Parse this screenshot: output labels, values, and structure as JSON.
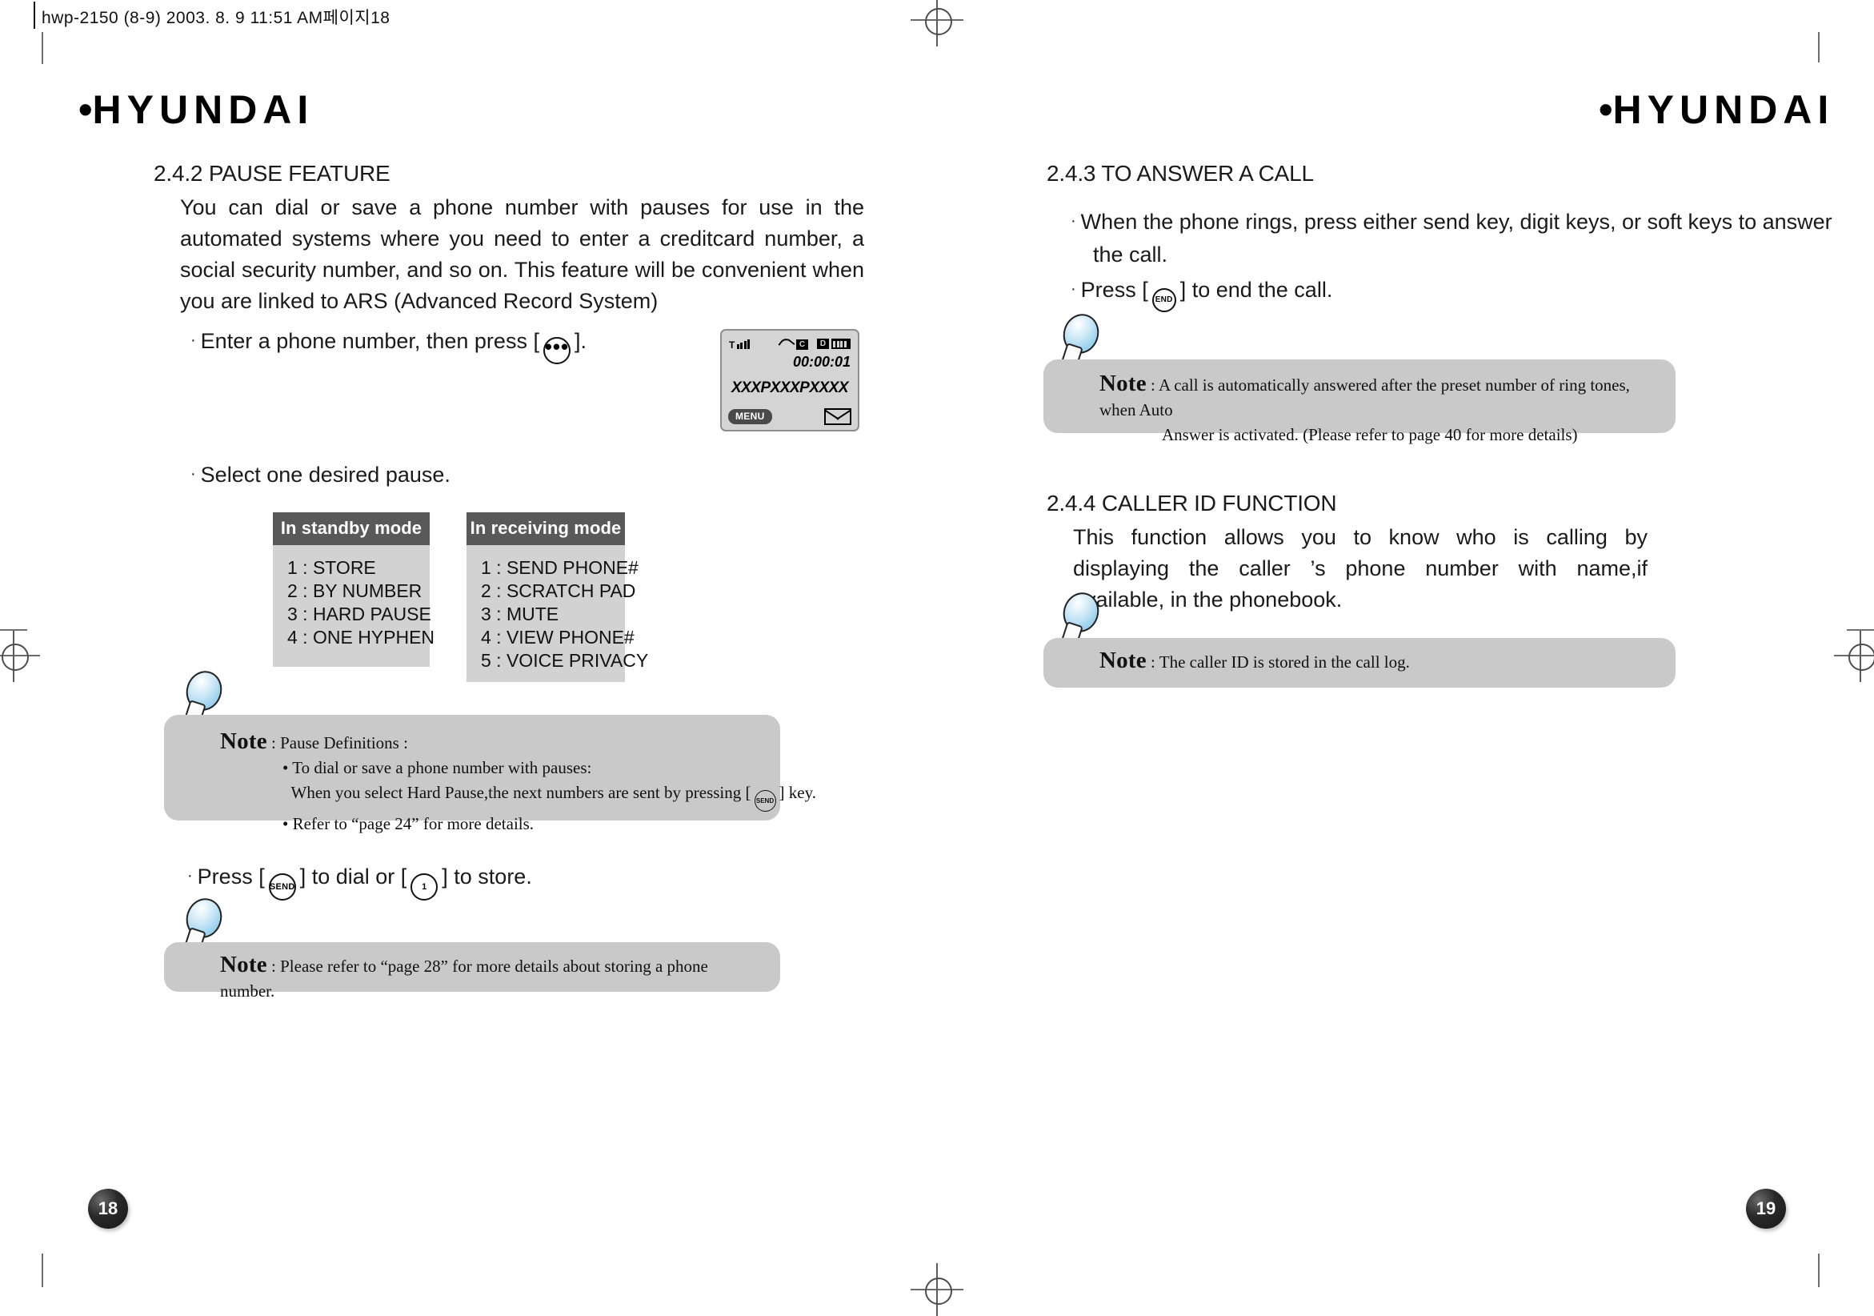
{
  "scan": {
    "header": "hwp-2150 (8-9)  2003. 8. 9 11:51 AM페이지18"
  },
  "brand": {
    "logo_mark": "•",
    "logo_text": "HYUNDAI"
  },
  "left_page": {
    "section_heading": "2.4.2 PAUSE FEATURE",
    "intro_paragraph": "You can dial or save a phone number with pauses for use in the automated systems where you need to enter a creditcard number, a social security number, and so on. This feature will be convenient when you are linked to ARS (Advanced Record System)",
    "step1_before": "Enter a phone number, then press [",
    "step1_key": "•••",
    "step1_after": "].",
    "step2": "Select one desired pause.",
    "step3_before": "Press [",
    "step3_key1": "SEND",
    "step3_middle": "] to dial or [",
    "step3_key2": "1",
    "step3_after": "] to store.",
    "lcd": {
      "timer": "00:00:01",
      "number": "XXXPXXXPXXXX",
      "softkey_left": "MENU",
      "signal_label": "T",
      "call_icon_label": "C",
      "data_icon_label": "D"
    },
    "standby_table": {
      "title": "In standby mode",
      "rows": [
        "1 : STORE",
        "2 : BY NUMBER",
        "3 : HARD PAUSE",
        "4 : ONE HYPHEN"
      ]
    },
    "receiving_table": {
      "title": "In receiving mode",
      "rows": [
        "1 : SEND PHONE#",
        "2 : SCRATCH PAD",
        "3 : MUTE",
        "4 : VIEW PHONE#",
        "5 : VOICE PRIVACY"
      ]
    },
    "note_pause": {
      "word": "Note",
      "lead": ": Pause Definitions :",
      "bullet1": "• To dial or save a phone number with pauses:",
      "bullet1_cont_before": "When you select Hard Pause,the next numbers are sent by pressing [",
      "bullet1_key": "SEND",
      "bullet1_cont_after": "] key.",
      "bullet2": "• Refer to “page 24” for more details."
    },
    "note_store": {
      "word": "Note",
      "text": ": Please refer to “page 28” for more details about storing a phone number."
    },
    "page_number": "18"
  },
  "right_page": {
    "section_heading_answer": "2.4.3 TO ANSWER A CALL",
    "answer_bullet1_line1": "When the phone rings, press either send key, digit keys, or soft keys to answer",
    "answer_bullet1_line2": "the call.",
    "answer_bullet2_before": "Press [",
    "answer_bullet2_key": "END",
    "answer_bullet2_after": "] to end the call.",
    "note_auto_answer": {
      "word": "Note",
      "line1": ": A call is automatically answered after the preset number of ring tones, when Auto",
      "line2": "Answer is activated. (Please refer to page 40 for more details)"
    },
    "section_heading_callerid": "2.4.4 CALLER ID FUNCTION",
    "callerid_paragraph": "This function allows you to know who is calling by displaying the caller ’s phone number with name,if available, in the phonebook.",
    "note_callerid": {
      "word": "Note",
      "text": ": The caller ID is stored in the call log."
    },
    "page_number": "19"
  }
}
